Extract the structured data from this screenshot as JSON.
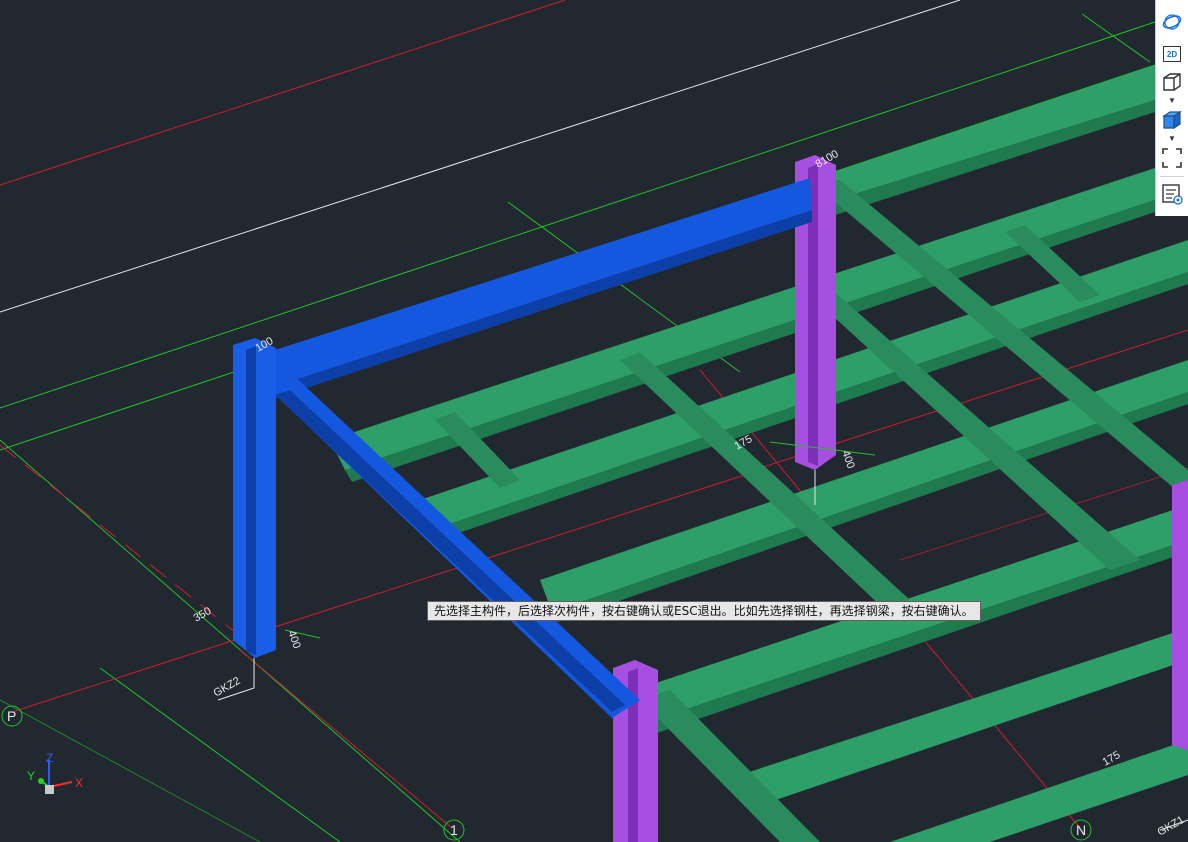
{
  "tooltip": {
    "text": "先选择主构件，后选择次构件，按右键确认或ESC退出。比如先选择钢柱，再选择钢梁，按右键确认。"
  },
  "toolbar": {
    "items": [
      {
        "name": "orbit",
        "icon": "orbit-icon"
      },
      {
        "name": "2d-view",
        "icon": "2d-view-icon",
        "label": "2D"
      },
      {
        "name": "wireframe-view",
        "icon": "wireframe-cube-icon"
      },
      {
        "name": "shaded-view",
        "icon": "shaded-cube-icon"
      },
      {
        "name": "zoom-extents",
        "icon": "zoom-extents-icon"
      },
      {
        "name": "layer-properties",
        "icon": "layer-properties-icon"
      }
    ]
  },
  "grid_labels": {
    "p": "P",
    "one": "1",
    "n": "N"
  },
  "dimensions": {
    "d100": "100",
    "d8100": "8100",
    "d350": "350",
    "d400_left": "400",
    "d175": "175",
    "d400_right": "400",
    "d175_right": "175"
  },
  "member_tags": {
    "gkz2": "GKZ2",
    "gkz1": "GKZ1"
  },
  "axes": {
    "x": "X",
    "y": "Y",
    "z": "Z"
  },
  "colors": {
    "background": "#212830",
    "selected_beam": "#1458e0",
    "selected_column": "#1a5ee8",
    "column": "#a64fe0",
    "beam": "#2e9f68",
    "grid_red": "#cf1c2e",
    "grid_green": "#22c22a",
    "line_white": "#e8e8e8"
  }
}
